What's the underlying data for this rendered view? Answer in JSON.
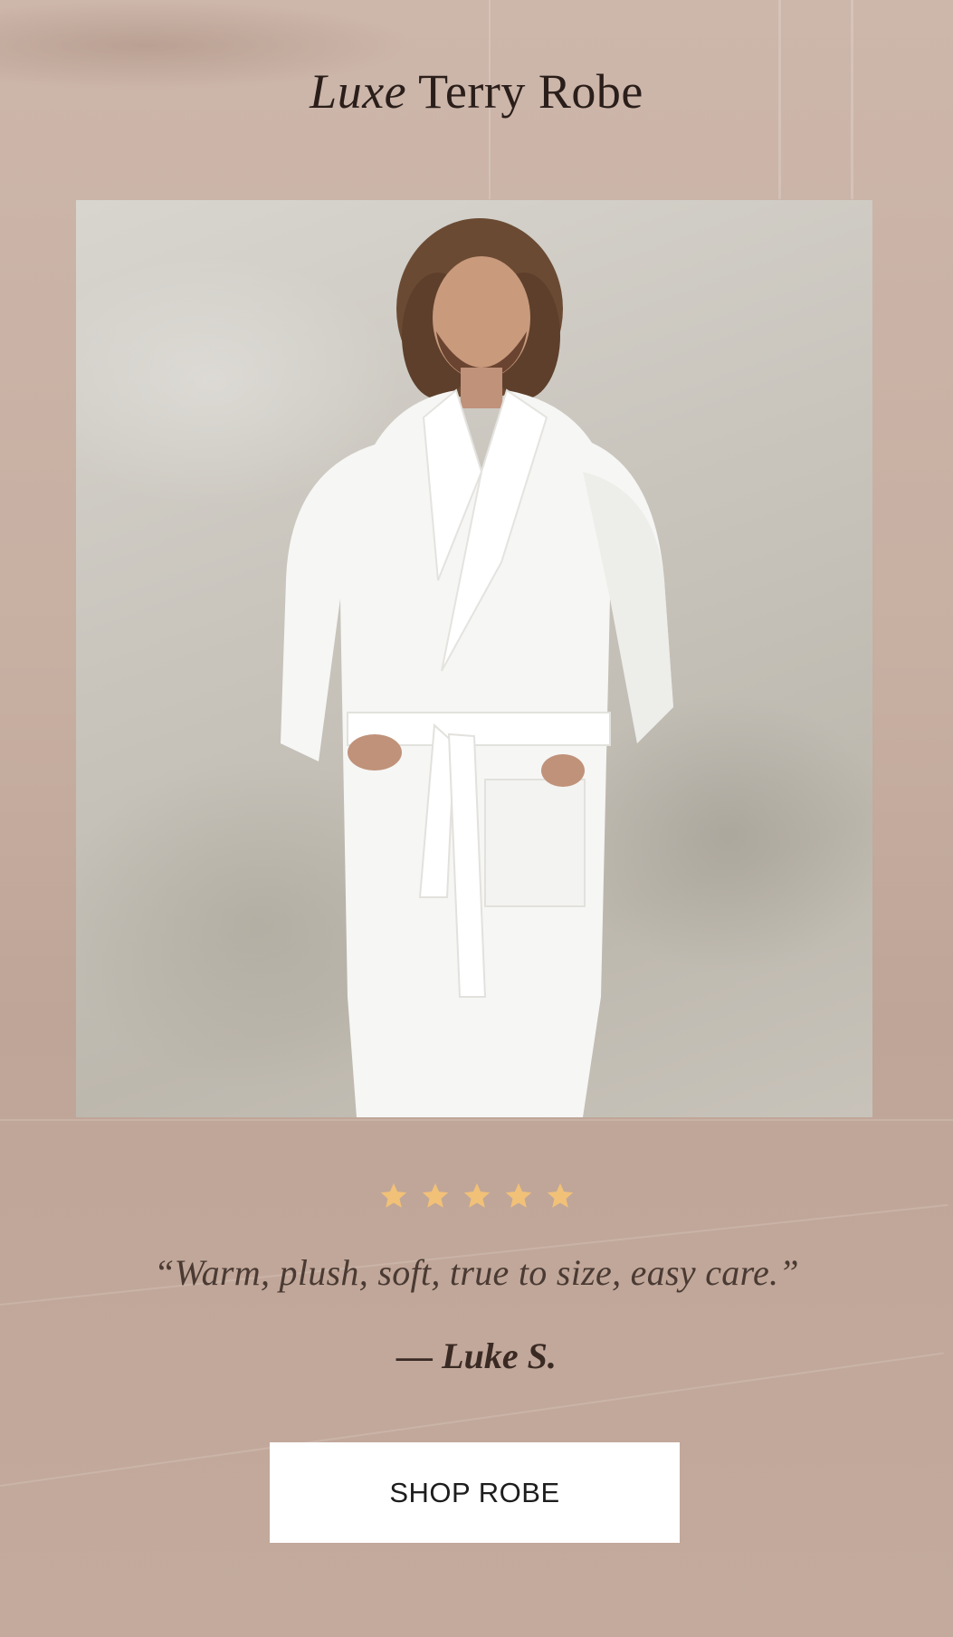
{
  "header": {
    "title_italic": "Luxe",
    "title_rest": "Terry Robe"
  },
  "hero_image": {
    "description_icon": "product-photo"
  },
  "rating": {
    "stars": 5,
    "star_color": "#f2c178"
  },
  "testimonial": {
    "quote": "“Warm, plush, soft, true to size, easy care.”",
    "author": "— Luke S."
  },
  "cta": {
    "label": "SHOP ROBE"
  },
  "colors": {
    "background": "#c6ada0",
    "title": "#2a1e1a",
    "button_bg": "#ffffff"
  }
}
